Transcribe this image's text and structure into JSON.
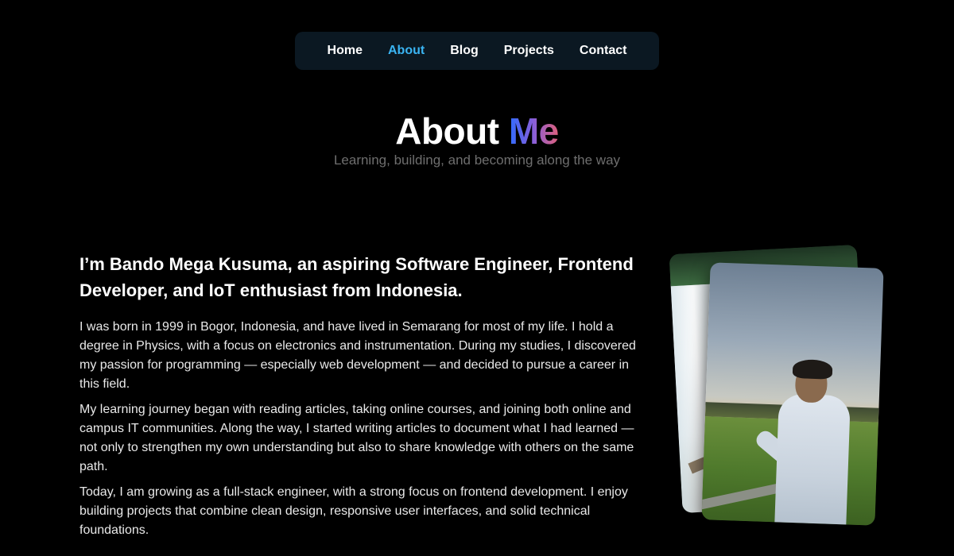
{
  "nav": {
    "items": [
      {
        "label": "Home"
      },
      {
        "label": "About"
      },
      {
        "label": "Blog"
      },
      {
        "label": "Projects"
      },
      {
        "label": "Contact"
      }
    ],
    "active": "About",
    "active_color": "#3ab4f2"
  },
  "hero": {
    "title_plain": "About ",
    "title_accent": "Me",
    "subtitle": "Learning, building, and becoming along the way"
  },
  "intro": {
    "headline": "I’m Bando Mega Kusuma, an aspiring Software Engineer, Frontend Developer, and IoT enthusiast from Indonesia.",
    "paragraphs": [
      "I was born in 1999 in Bogor, Indonesia, and have lived in Semarang for most of my life. I hold a degree in Physics, with a focus on electronics and instrumentation. During my studies, I discovered my passion for programming — especially web development — and decided to pursue a career in this field.",
      "My learning journey began with reading articles, taking online courses, and joining both online and campus IT communities. Along the way, I started writing articles to document what I had learned — not only to strengthen my own understanding but also to share knowledge with others on the same path.",
      "Today, I am growing as a full-stack engineer, with a strong focus on frontend development. I enjoy building projects that combine clean design, responsive user interfaces, and solid technical foundations."
    ]
  },
  "colors": {
    "background": "#000000",
    "nav_background": "#0b1822",
    "subtitle": "#6e6e6e"
  }
}
